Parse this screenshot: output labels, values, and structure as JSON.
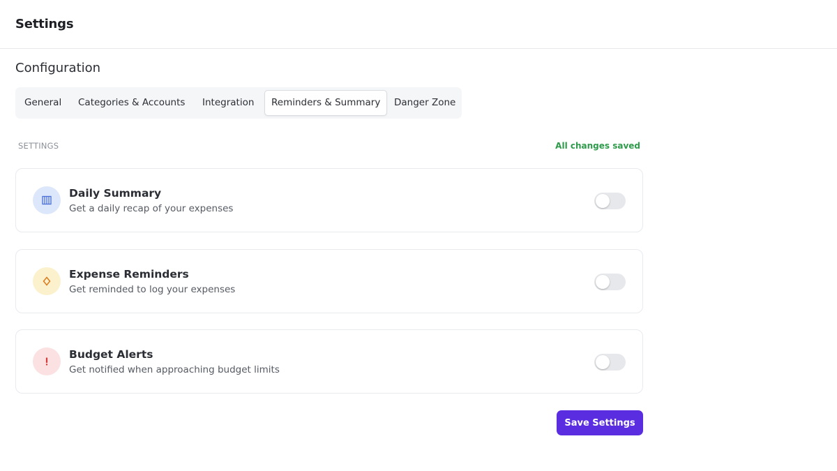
{
  "header": {
    "title": "Settings"
  },
  "config": {
    "title": "Configuration",
    "tabs": [
      {
        "label": "General",
        "active": false
      },
      {
        "label": "Categories & Accounts",
        "active": false
      },
      {
        "label": "Integration",
        "active": false
      },
      {
        "label": "Reminders & Summary",
        "active": true
      },
      {
        "label": "Danger Zone",
        "active": false
      }
    ]
  },
  "settings": {
    "label": "SETTINGS",
    "status": "All changes saved",
    "items": [
      {
        "title": "Daily Summary",
        "description": "Get a daily recap of your expenses",
        "icon": "calendar-icon",
        "enabled": false
      },
      {
        "title": "Expense Reminders",
        "description": "Get reminded to log your expenses",
        "icon": "bell-icon",
        "enabled": false
      },
      {
        "title": "Budget Alerts",
        "description": "Get notified when approaching budget limits",
        "icon": "alert-icon",
        "enabled": false
      }
    ]
  },
  "actions": {
    "save_label": "Save Settings"
  },
  "colors": {
    "accent": "#5b2de0",
    "saved_status": "#2e9b4a",
    "daily_icon_bg": "#dde7fb",
    "daily_icon": "#4b6fd8",
    "reminder_icon_bg": "#fcf1cd",
    "reminder_icon": "#d97a1c",
    "alert_icon_bg": "#fbe1e1",
    "alert_icon": "#d63b3b"
  }
}
